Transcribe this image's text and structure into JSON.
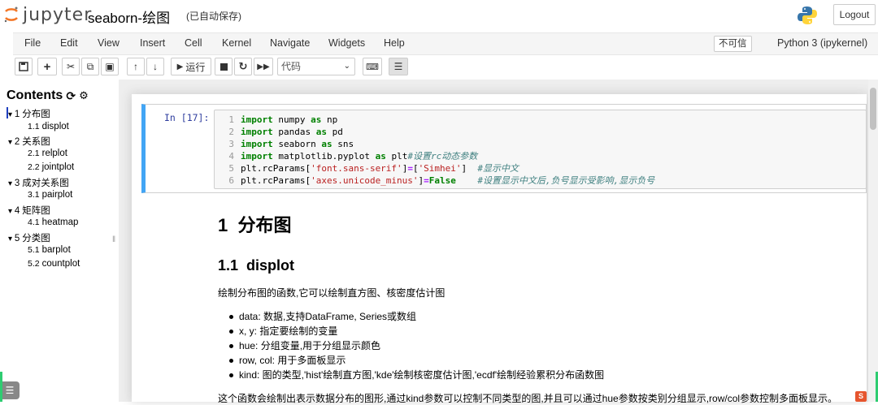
{
  "header": {
    "logo_text": "jupyter",
    "notebook_title": "seaborn-绘图",
    "autosave_status": "(已自动保存)",
    "logout_label": "Logout"
  },
  "menubar": {
    "items": [
      "File",
      "Edit",
      "View",
      "Insert",
      "Cell",
      "Kernel",
      "Navigate",
      "Widgets",
      "Help"
    ],
    "trusted_label": "不可信",
    "kernel_name": "Python 3 (ipykernel)"
  },
  "toolbar": {
    "run_label": "运行",
    "cell_type": "代码"
  },
  "toc": {
    "title": "Contents",
    "items": [
      {
        "num": "1",
        "label": "分布图",
        "level": 1,
        "expanded": true
      },
      {
        "num": "1.1",
        "label": "displot",
        "level": 2
      },
      {
        "num": "2",
        "label": "关系图",
        "level": 1,
        "expanded": true
      },
      {
        "num": "2.1",
        "label": "relplot",
        "level": 2
      },
      {
        "num": "2.2",
        "label": "jointplot",
        "level": 2
      },
      {
        "num": "3",
        "label": "成对关系图",
        "level": 1,
        "expanded": true
      },
      {
        "num": "3.1",
        "label": "pairplot",
        "level": 2
      },
      {
        "num": "4",
        "label": "矩阵图",
        "level": 1,
        "expanded": true
      },
      {
        "num": "4.1",
        "label": "heatmap",
        "level": 2
      },
      {
        "num": "5",
        "label": "分类图",
        "level": 1,
        "expanded": true
      },
      {
        "num": "5.1",
        "label": "barplot",
        "level": 2
      },
      {
        "num": "5.2",
        "label": "countplot",
        "level": 2
      }
    ]
  },
  "code_cell": {
    "prompt": "In  [17]:",
    "line_numbers": [
      "1",
      "2",
      "3",
      "4",
      "5",
      "6"
    ]
  },
  "markdown": {
    "h1_num": "1",
    "h1_text": "分布图",
    "h2_num": "1.1",
    "h2_text": "displot",
    "intro": "绘制分布图的函数,它可以绘制直方图、核密度估计图",
    "bullets": [
      "data: 数据,支持DataFrame, Series或数组",
      "x, y: 指定要绘制的变量",
      "hue: 分组变量,用于分组显示颜色",
      "row, col: 用于多面板显示",
      "kind: 图的类型,'hist'绘制直方图,'kde'绘制核密度估计图,'ecdf'绘制经验累积分布函数图"
    ],
    "footer_text": "这个函数会绘制出表示数据分布的图形,通过kind参数可以控制不同类型的图,并且可以通过hue参数按类别分组显示,row/col参数控制多面板显示。"
  },
  "colors": {
    "selected_cell_border": "#42a5f5",
    "prompt": "#303f9f",
    "keyword": "#008000",
    "string": "#ba2121",
    "comment": "#408080"
  }
}
